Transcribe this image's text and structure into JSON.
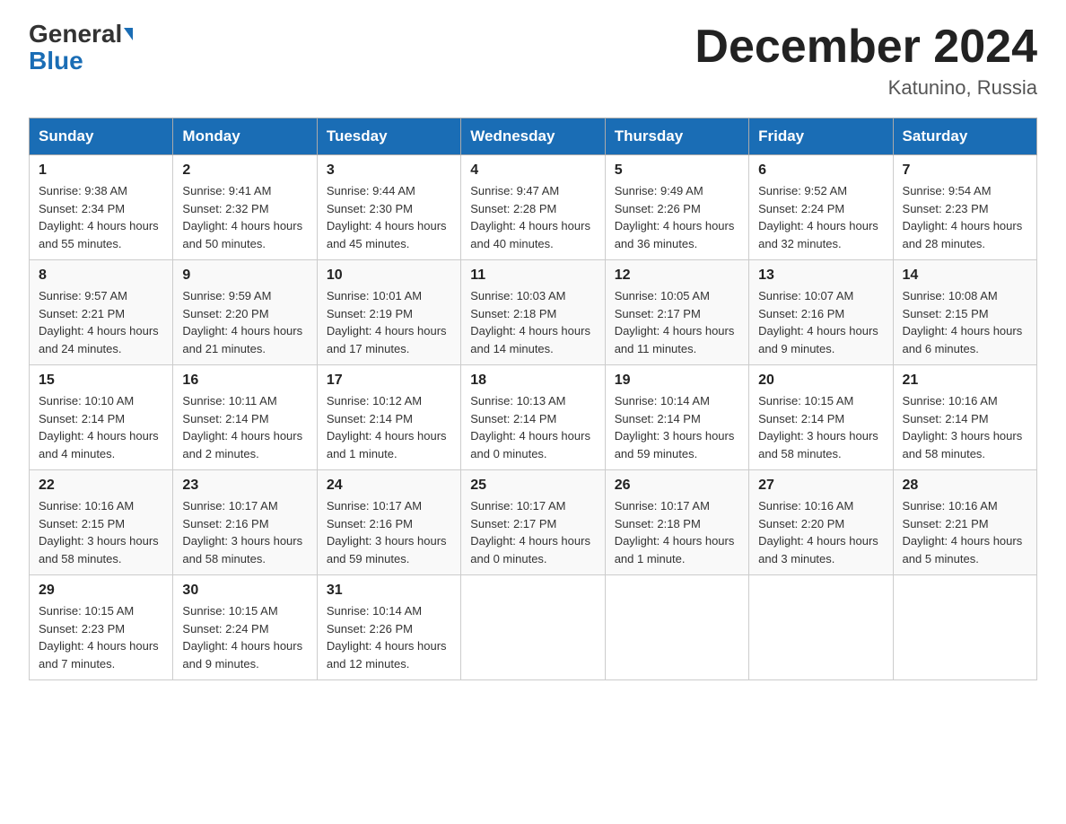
{
  "header": {
    "logo_general": "General",
    "logo_blue": "Blue",
    "month_title": "December 2024",
    "location": "Katunino, Russia"
  },
  "weekdays": [
    "Sunday",
    "Monday",
    "Tuesday",
    "Wednesday",
    "Thursday",
    "Friday",
    "Saturday"
  ],
  "weeks": [
    [
      {
        "day": "1",
        "sunrise": "9:38 AM",
        "sunset": "2:34 PM",
        "daylight": "4 hours and 55 minutes."
      },
      {
        "day": "2",
        "sunrise": "9:41 AM",
        "sunset": "2:32 PM",
        "daylight": "4 hours and 50 minutes."
      },
      {
        "day": "3",
        "sunrise": "9:44 AM",
        "sunset": "2:30 PM",
        "daylight": "4 hours and 45 minutes."
      },
      {
        "day": "4",
        "sunrise": "9:47 AM",
        "sunset": "2:28 PM",
        "daylight": "4 hours and 40 minutes."
      },
      {
        "day": "5",
        "sunrise": "9:49 AM",
        "sunset": "2:26 PM",
        "daylight": "4 hours and 36 minutes."
      },
      {
        "day": "6",
        "sunrise": "9:52 AM",
        "sunset": "2:24 PM",
        "daylight": "4 hours and 32 minutes."
      },
      {
        "day": "7",
        "sunrise": "9:54 AM",
        "sunset": "2:23 PM",
        "daylight": "4 hours and 28 minutes."
      }
    ],
    [
      {
        "day": "8",
        "sunrise": "9:57 AM",
        "sunset": "2:21 PM",
        "daylight": "4 hours and 24 minutes."
      },
      {
        "day": "9",
        "sunrise": "9:59 AM",
        "sunset": "2:20 PM",
        "daylight": "4 hours and 21 minutes."
      },
      {
        "day": "10",
        "sunrise": "10:01 AM",
        "sunset": "2:19 PM",
        "daylight": "4 hours and 17 minutes."
      },
      {
        "day": "11",
        "sunrise": "10:03 AM",
        "sunset": "2:18 PM",
        "daylight": "4 hours and 14 minutes."
      },
      {
        "day": "12",
        "sunrise": "10:05 AM",
        "sunset": "2:17 PM",
        "daylight": "4 hours and 11 minutes."
      },
      {
        "day": "13",
        "sunrise": "10:07 AM",
        "sunset": "2:16 PM",
        "daylight": "4 hours and 9 minutes."
      },
      {
        "day": "14",
        "sunrise": "10:08 AM",
        "sunset": "2:15 PM",
        "daylight": "4 hours and 6 minutes."
      }
    ],
    [
      {
        "day": "15",
        "sunrise": "10:10 AM",
        "sunset": "2:14 PM",
        "daylight": "4 hours and 4 minutes."
      },
      {
        "day": "16",
        "sunrise": "10:11 AM",
        "sunset": "2:14 PM",
        "daylight": "4 hours and 2 minutes."
      },
      {
        "day": "17",
        "sunrise": "10:12 AM",
        "sunset": "2:14 PM",
        "daylight": "4 hours and 1 minute."
      },
      {
        "day": "18",
        "sunrise": "10:13 AM",
        "sunset": "2:14 PM",
        "daylight": "4 hours and 0 minutes."
      },
      {
        "day": "19",
        "sunrise": "10:14 AM",
        "sunset": "2:14 PM",
        "daylight": "3 hours and 59 minutes."
      },
      {
        "day": "20",
        "sunrise": "10:15 AM",
        "sunset": "2:14 PM",
        "daylight": "3 hours and 58 minutes."
      },
      {
        "day": "21",
        "sunrise": "10:16 AM",
        "sunset": "2:14 PM",
        "daylight": "3 hours and 58 minutes."
      }
    ],
    [
      {
        "day": "22",
        "sunrise": "10:16 AM",
        "sunset": "2:15 PM",
        "daylight": "3 hours and 58 minutes."
      },
      {
        "day": "23",
        "sunrise": "10:17 AM",
        "sunset": "2:16 PM",
        "daylight": "3 hours and 58 minutes."
      },
      {
        "day": "24",
        "sunrise": "10:17 AM",
        "sunset": "2:16 PM",
        "daylight": "3 hours and 59 minutes."
      },
      {
        "day": "25",
        "sunrise": "10:17 AM",
        "sunset": "2:17 PM",
        "daylight": "4 hours and 0 minutes."
      },
      {
        "day": "26",
        "sunrise": "10:17 AM",
        "sunset": "2:18 PM",
        "daylight": "4 hours and 1 minute."
      },
      {
        "day": "27",
        "sunrise": "10:16 AM",
        "sunset": "2:20 PM",
        "daylight": "4 hours and 3 minutes."
      },
      {
        "day": "28",
        "sunrise": "10:16 AM",
        "sunset": "2:21 PM",
        "daylight": "4 hours and 5 minutes."
      }
    ],
    [
      {
        "day": "29",
        "sunrise": "10:15 AM",
        "sunset": "2:23 PM",
        "daylight": "4 hours and 7 minutes."
      },
      {
        "day": "30",
        "sunrise": "10:15 AM",
        "sunset": "2:24 PM",
        "daylight": "4 hours and 9 minutes."
      },
      {
        "day": "31",
        "sunrise": "10:14 AM",
        "sunset": "2:26 PM",
        "daylight": "4 hours and 12 minutes."
      },
      null,
      null,
      null,
      null
    ]
  ]
}
